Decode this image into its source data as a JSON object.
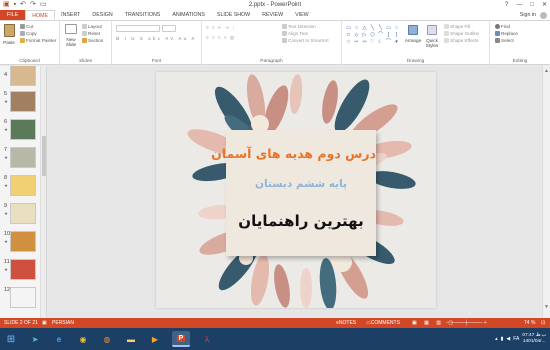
{
  "window": {
    "title": "2.pptx - PowerPoint",
    "controls": [
      "?",
      "—",
      "□",
      "✕"
    ]
  },
  "tabs": [
    {
      "label": "FILE"
    },
    {
      "label": "HOME"
    },
    {
      "label": "INSERT"
    },
    {
      "label": "DESIGN"
    },
    {
      "label": "TRANSITIONS"
    },
    {
      "label": "ANIMATIONS"
    },
    {
      "label": "SLIDE SHOW"
    },
    {
      "label": "REVIEW"
    },
    {
      "label": "VIEW"
    }
  ],
  "account": {
    "sign_in": "Sign in"
  },
  "ribbon": {
    "clipboard": {
      "paste": "Paste",
      "cut": "Cut",
      "copy": "Copy",
      "format_painter": "Format Painter",
      "label": "Clipboard"
    },
    "slides": {
      "new_slide_1": "New",
      "new_slide_2": "Slide",
      "layout": "Layout",
      "reset": "Reset",
      "section": "Section",
      "label": "Slides"
    },
    "font": {
      "label": "Font"
    },
    "paragraph": {
      "text_direction": "Text Direction",
      "align_text": "Align Text",
      "smartart": "Convert to SmartArt",
      "label": "Paragraph"
    },
    "drawing": {
      "arrange": "Arrange",
      "quick_styles_1": "Quick",
      "quick_styles_2": "Styles",
      "shape_fill": "Shape Fill",
      "shape_outline": "Shape Outline",
      "shape_effects": "Shape Effects",
      "label": "Drawing"
    },
    "editing": {
      "find": "Find",
      "replace": "Replace",
      "select": "Select",
      "label": "Editing"
    }
  },
  "thumbnails": [
    {
      "num": "4",
      "color": "#c9a06a"
    },
    {
      "num": "5",
      "color": "#8a6a3a"
    },
    {
      "num": "6",
      "color": "#4a6a4a"
    },
    {
      "num": "7",
      "color": "#9a9a8a"
    },
    {
      "num": "8",
      "color": "#e0b040"
    },
    {
      "num": "9",
      "color": "#d8d0b0"
    },
    {
      "num": "10",
      "color": "#c08030"
    },
    {
      "num": "11",
      "color": "#c04030"
    },
    {
      "num": "12",
      "color": "#e8e8e8"
    }
  ],
  "slide": {
    "title": "درس دوم هدیه های آسمان",
    "grade": "پایه ششم دبستان",
    "teachers": "بهترین راهنمایان"
  },
  "status": {
    "slide_info": "SLIDE 2 OF 21",
    "language": "PERSIAN",
    "notes": "NOTES",
    "comments": "COMMENTS",
    "zoom": "74 %"
  },
  "taskbar": {
    "language": "FA",
    "time": "07:47 ب.ظ",
    "date": "1401/04/..."
  }
}
